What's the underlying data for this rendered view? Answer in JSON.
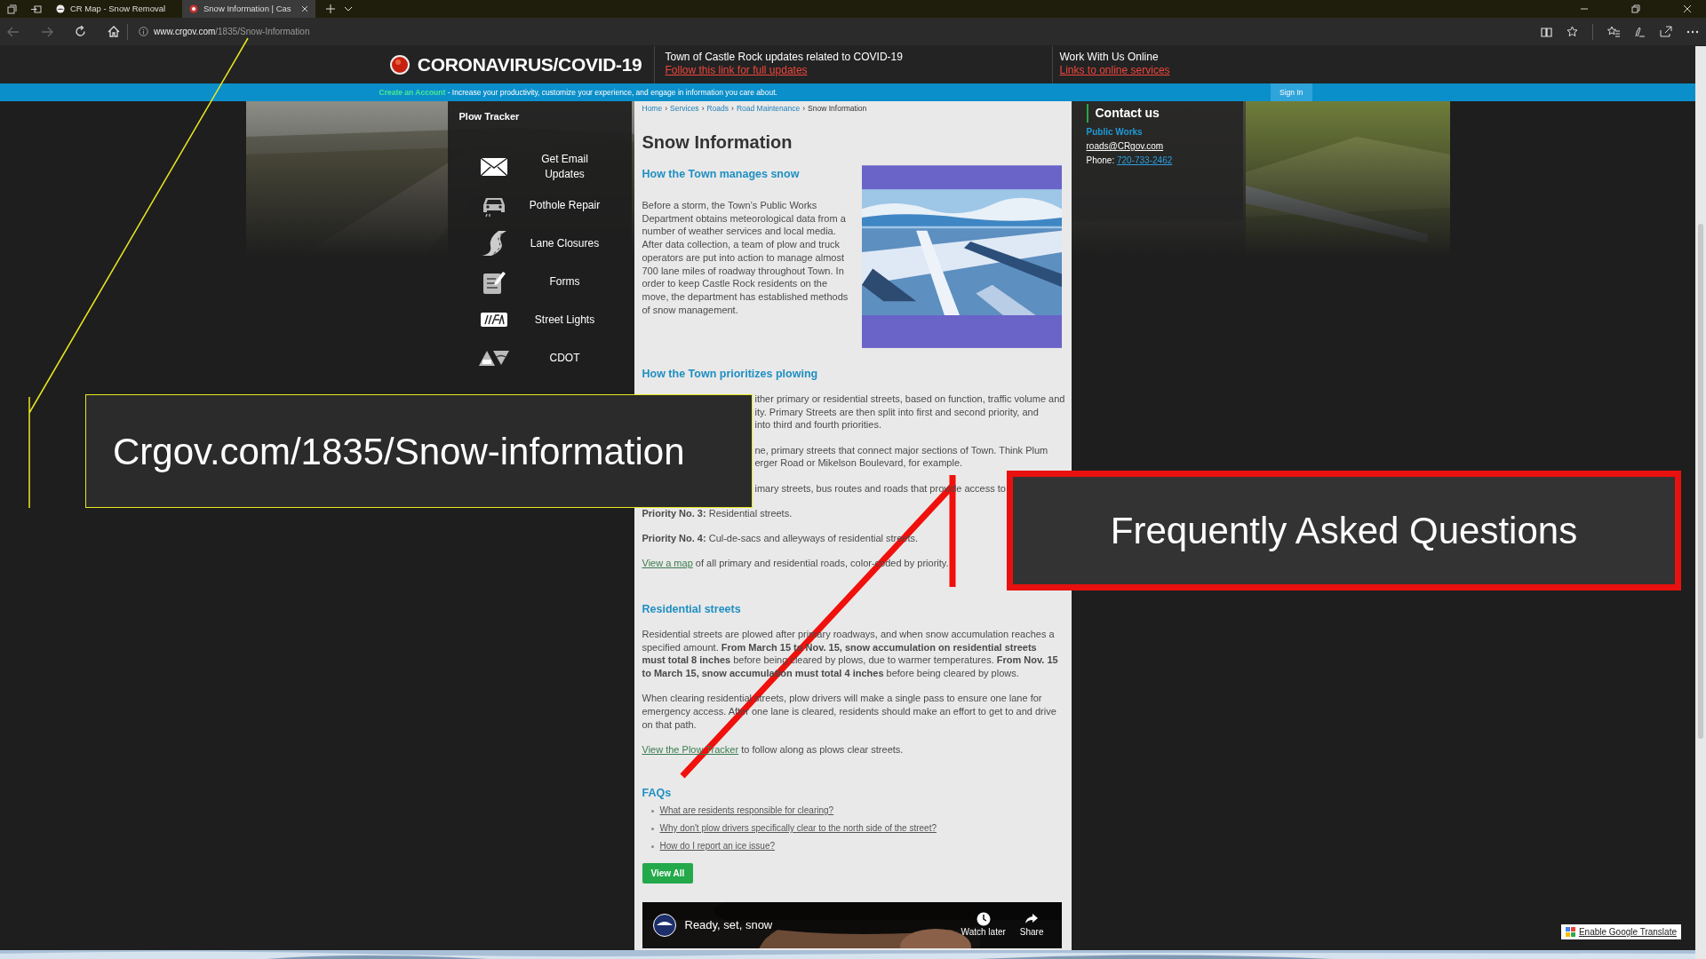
{
  "browser": {
    "tabs": [
      {
        "title": "CR Map - Snow Removal",
        "selected": false
      },
      {
        "title": "Snow Information | Cas",
        "selected": true
      }
    ],
    "url_domain": "www.crgov.com",
    "url_path": "/1835/Snow-Information"
  },
  "header": {
    "covid_title": "CORONAVIRUS/COVID-19",
    "updates_title": "Town of Castle Rock updates related to COVID-19",
    "updates_link": "Follow this link for full updates",
    "work_title": "Work With Us Online",
    "work_link": "Links to online services"
  },
  "account_bar": {
    "link": "Create an Account",
    "text": " - Increase your productivity, customize your experience, and engage in information you care about.",
    "sign_in": "Sign In"
  },
  "sidebar": {
    "title": "Plow Tracker",
    "items": [
      {
        "label": "Get Email Updates"
      },
      {
        "label": "Pothole Repair"
      },
      {
        "label": "Lane Closures"
      },
      {
        "label": "Forms"
      },
      {
        "label": "Street Lights"
      },
      {
        "label": "CDOT"
      }
    ]
  },
  "content": {
    "breadcrumbs": [
      {
        "label": "Home",
        "link": true
      },
      {
        "label": "Services",
        "link": true
      },
      {
        "label": "Roads",
        "link": true
      },
      {
        "label": "Road Maintenance",
        "link": true
      },
      {
        "label": "Snow Information",
        "link": false
      }
    ],
    "separator": "›",
    "title": "Snow Information",
    "sections": [
      {
        "heading": "How the Town manages snow",
        "image": {
          "kind": "picture"
        },
        "blocks": [
          {
            "kind": "text",
            "text": "Before a storm, the Town’s Public Works Department obtains meteorological data from a number of weather services and local media. After data collection, a team of plow and truck operators are put into action to manage almost 700 lane miles of roadway throughout Town. In order to keep Castle Rock residents on the move, the department has established methods of snow management."
          }
        ]
      },
      {
        "heading": "How the Town prioritizes plowing",
        "blocks": [
          {
            "kind": "cut",
            "lines": [
              "ither primary or residential streets, based on function, traffic volume and",
              "ity. Primary Streets are then split into first and second priority, and",
              "into third and fourth priorities."
            ]
          },
          {
            "kind": "cut",
            "lines": [
              "ne, primary streets that connect major sections of Town. Think Plum",
              "erger Road or Mikelson Boulevard, for example."
            ]
          },
          {
            "kind": "cut",
            "lines": [
              "imary streets, bus routes and roads that provide access to"
            ]
          },
          {
            "kind": "text",
            "text": "**Priority No. 3:** Residential streets."
          },
          {
            "kind": "text",
            "text": "**Priority No. 4:** Cul-de-sacs and alleyways of residential streets."
          },
          {
            "kind": "link",
            "link": "View a map",
            "text": " of all primary and residential roads, color-coded by priority."
          }
        ]
      },
      {
        "heading": "Residential streets",
        "blocks": [
          {
            "kind": "text",
            "text": "Residential streets are plowed after primary roadways, and when snow accumulation reaches a specified amount. **From March 15 to Nov. 15, snow accumulation on residential streets must total 8 inches** before being cleared by plows, due to warmer temperatures. **From Nov. 15 to March 15, snow accumulation must total 4 inches** before being cleared by plows."
          },
          {
            "kind": "text",
            "text": "When clearing residential streets, plow drivers will make a single pass to ensure one lane for emergency access. After one lane is cleared, residents should make an effort to get to and drive on that path."
          },
          {
            "kind": "link",
            "link": "View the Plow Tracker",
            "text": " to follow along as plows clear streets."
          }
        ]
      }
    ],
    "faqs": {
      "heading": "FAQs",
      "items": [
        "What are residents responsible for clearing?",
        "Why don't plow drivers specifically clear to the north side of the street?",
        "How do I report an ice issue?"
      ],
      "button": "View All"
    },
    "video": {
      "title": "Ready, set, snow",
      "actions": [
        {
          "label": "Watch later"
        },
        {
          "label": "Share"
        }
      ]
    }
  },
  "contact": {
    "title": "Contact us",
    "department": "Public Works",
    "email": "roads@CRgov.com",
    "phone_label": "Phone: ",
    "phone": "720-733-2462"
  },
  "translate": "Enable Google Translate",
  "annotations": {
    "url_callout": "Crgov.com/1835/Snow-information",
    "faq_callout": "Frequently Asked Questions"
  }
}
